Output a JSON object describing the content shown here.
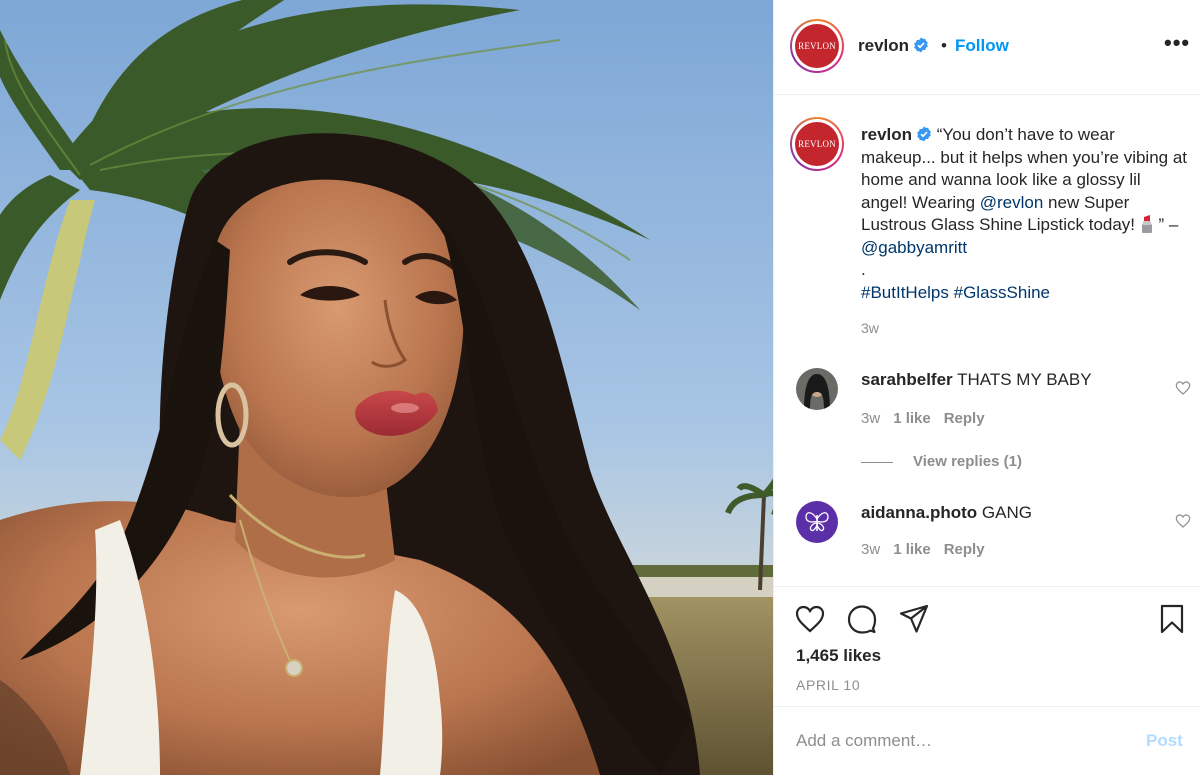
{
  "post": {
    "image_alt": "Woman with long dark wavy hair taking a selfie outdoors in front of a palm tree, wearing a white tank top and glossy red lipstick",
    "account": {
      "username": "revlon",
      "verified": true,
      "logo_text": "REVLON",
      "follow_label": "Follow",
      "separator": "•",
      "more_label": "•••"
    },
    "caption": {
      "username": "revlon",
      "text_part1": " “You don’t have to wear makeup... but it helps when you’re vibing at home and wanna look like a glossy lil angel! Wearing ",
      "mention1": "@revlon",
      "text_part2": " new Super Lustrous Glass Shine Lipstick today! ",
      "text_part3": " ” – ",
      "mention2": "@gabbyamritt",
      "dot": ".",
      "hashtag1": "#ButItHelps",
      "hashtag2": "#GlassShine",
      "time": "3w"
    },
    "comments": [
      {
        "username": "sarahbelfer",
        "text": "THATS MY BABY",
        "time": "3w",
        "likes": "1 like",
        "reply": "Reply",
        "view_replies": "View replies (1)"
      },
      {
        "username": "aidanna.photo",
        "text": "GANG",
        "time": "3w",
        "likes": "1 like",
        "reply": "Reply"
      }
    ],
    "likes_count": "1,465 likes",
    "date": "APRIL 10",
    "add_comment_placeholder": "Add a comment…",
    "post_label": "Post"
  },
  "colors": {
    "link_blue": "#0095f6",
    "mention": "#00376b",
    "revlon_red": "#c4262e",
    "muted": "#8e8e8e",
    "post_disabled": "#b3dbff"
  }
}
